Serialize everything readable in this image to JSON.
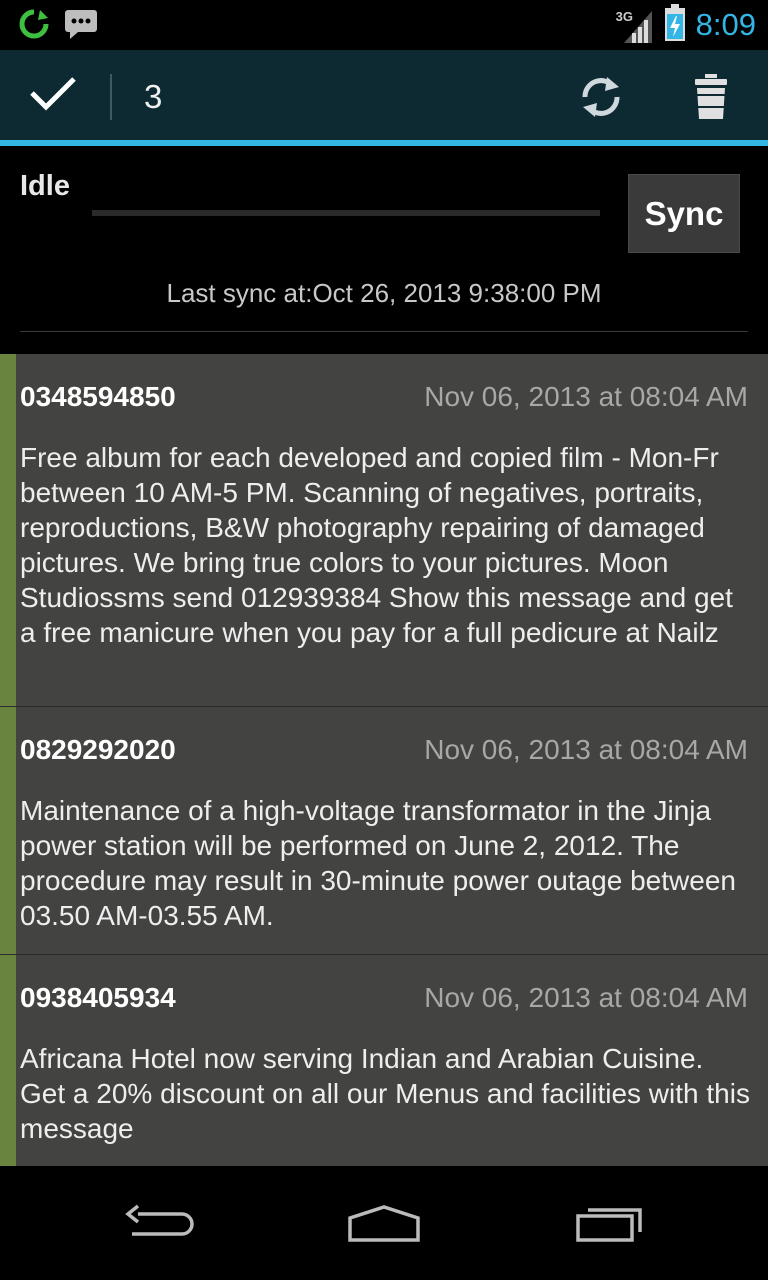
{
  "status_bar": {
    "time": "8:09",
    "network_type": "3G",
    "icons": [
      "sync-circle-icon",
      "chat-icon",
      "signal-icon",
      "battery-charging-icon"
    ]
  },
  "action_bar": {
    "selected_count": "3",
    "icons": [
      "checkmark-icon",
      "refresh-icon",
      "trash-icon"
    ]
  },
  "sync_panel": {
    "status": "Idle",
    "button_label": "Sync",
    "last_sync": "Last sync at:Oct 26, 2013 9:38:00 PM"
  },
  "messages": [
    {
      "sender": "0348594850",
      "date": "Nov 06, 2013 at 08:04 AM",
      "body": "Free album for each developed and copied film - Mon-Fr between 10 AM-5 PM. Scanning of negatives, portraits, reproductions, B&W photography repairing of damaged pictures. We bring true colors to your pictures. Moon Studiossms send 012939384 Show this message and get a free manicure when you pay for a full pedicure at Nailz"
    },
    {
      "sender": "0829292020",
      "date": "Nov 06, 2013 at 08:04 AM",
      "body": "Maintenance of a high-voltage transformator in the Jinja power station will be performed on June 2, 2012. The procedure may result in 30-minute power outage between 03.50 AM-03.55 AM."
    },
    {
      "sender": "0938405934",
      "date": "Nov 06, 2013 at 08:04 AM",
      "body": "Africana Hotel now serving Indian and Arabian Cuisine. Get a 20% discount on all our Menus and facilities with this message"
    }
  ],
  "nav_bar": {
    "icons": [
      "back-icon",
      "home-icon",
      "recent-apps-icon"
    ]
  },
  "colors": {
    "accent": "#33b5e5",
    "action_bar_bg": "#0d2a33",
    "message_bg": "#434341",
    "message_accent": "#68843f"
  }
}
